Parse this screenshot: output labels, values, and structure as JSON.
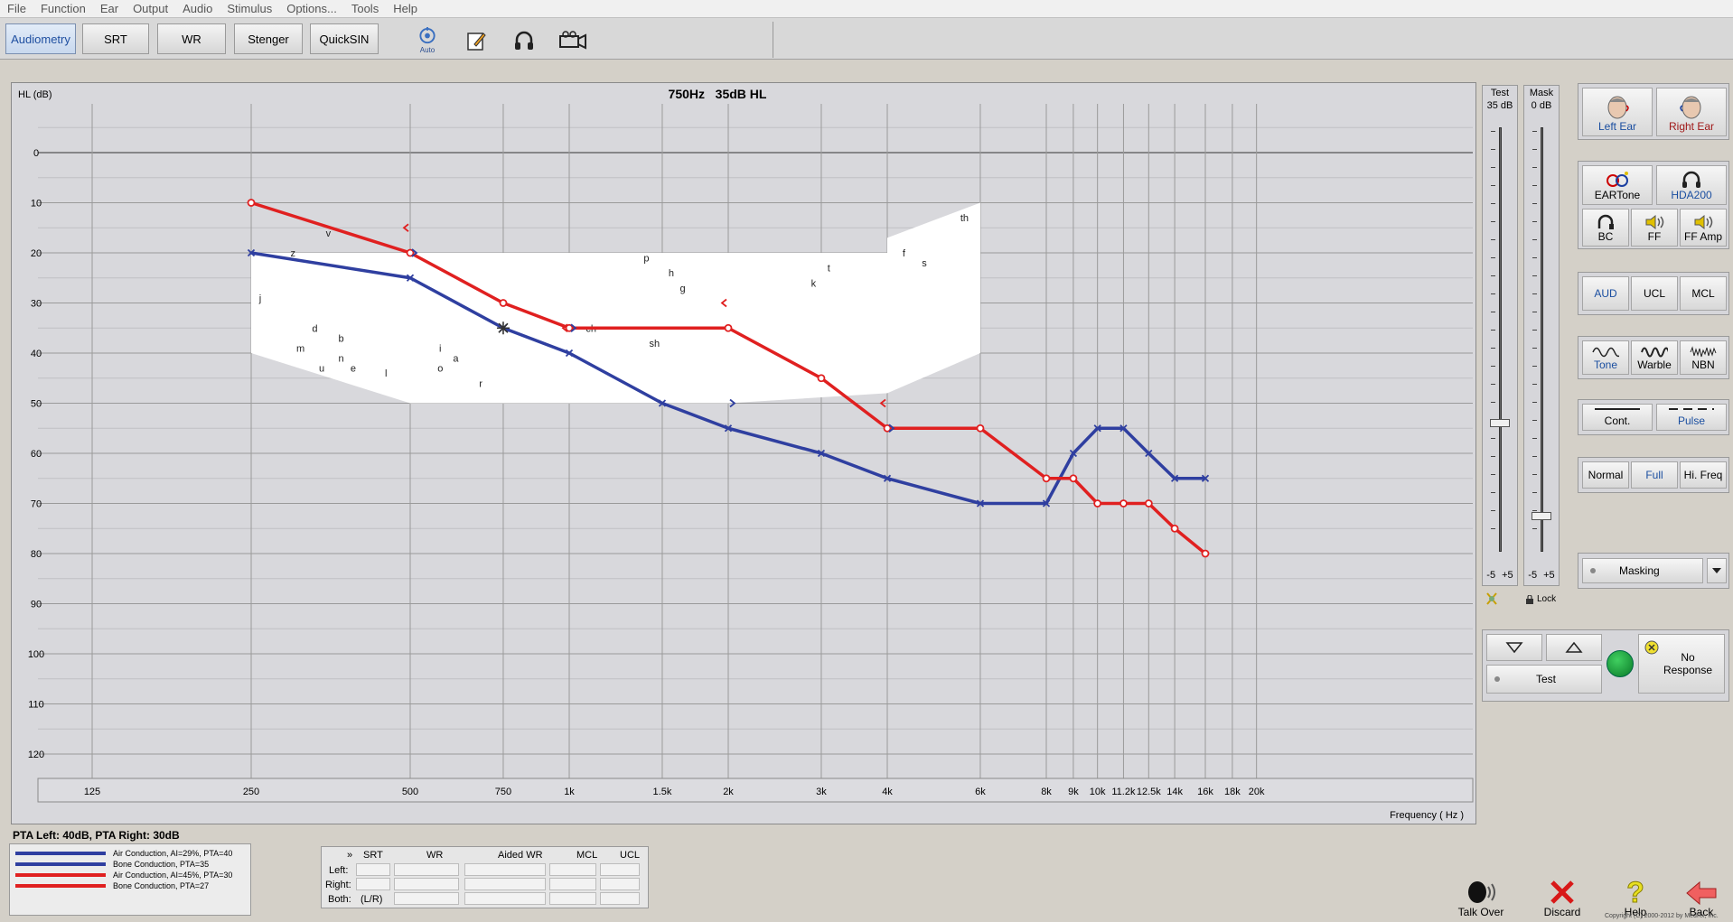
{
  "menu": [
    "File",
    "Function",
    "Ear",
    "Output",
    "Audio",
    "Stimulus",
    "Options...",
    "Tools",
    "Help"
  ],
  "toolbar": {
    "tabs": [
      "Audiometry",
      "SRT",
      "WR",
      "Stenger",
      "QuickSIN"
    ],
    "auto_label": "Auto"
  },
  "graph": {
    "y_label": "HL (dB)",
    "status": "750Hz   35dB HL",
    "x_unit_label": "Frequency ( Hz )",
    "y_ticks": [
      "0",
      "10",
      "20",
      "30",
      "40",
      "50",
      "60",
      "70",
      "80",
      "90",
      "100",
      "110",
      "120"
    ],
    "x_ticks": [
      "125",
      "250",
      "500",
      "750",
      "1k",
      "1.5k",
      "2k",
      "3k",
      "4k",
      "6k",
      "8k",
      "9k",
      "10k",
      "11.2k",
      "12.5k",
      "14k",
      "16k",
      "18k",
      "20k"
    ],
    "speech_sounds": [
      "v",
      "z",
      "j",
      "d",
      "b",
      "m",
      "n",
      "u",
      "e",
      "l",
      "i",
      "a",
      "o",
      "r",
      "p",
      "h",
      "g",
      "ch",
      "sh",
      "k",
      "t",
      "f",
      "s",
      "th"
    ]
  },
  "chart_data": {
    "type": "line",
    "xlabel": "Frequency ( Hz )",
    "ylabel": "HL (dB)",
    "ylim": [
      -10,
      120
    ],
    "y_inverted": true,
    "x_scale": "log",
    "series": [
      {
        "name": "Air Conduction, AI=29%, PTA=40",
        "ear": "left",
        "color": "#2f3fa0",
        "x": [
          250,
          500,
          750,
          1000,
          1500,
          2000,
          3000,
          4000,
          6000,
          8000,
          9000,
          10000,
          11200,
          12500,
          14000,
          16000
        ],
        "y": [
          20,
          25,
          35,
          40,
          50,
          55,
          60,
          65,
          70,
          70,
          60,
          55,
          55,
          60,
          65,
          65
        ]
      },
      {
        "name": "Air Conduction, AI=45%, PTA=30",
        "ear": "right",
        "color": "#e02020",
        "x": [
          250,
          500,
          750,
          1000,
          2000,
          3000,
          4000,
          6000,
          8000,
          9000,
          10000,
          11200,
          12500,
          14000,
          16000
        ],
        "y": [
          10,
          20,
          30,
          35,
          35,
          45,
          55,
          55,
          65,
          65,
          70,
          70,
          70,
          75,
          80
        ]
      },
      {
        "name": "Bone Conduction, PTA=35",
        "ear": "left",
        "color": "#2f3fa0",
        "x": [
          500,
          1000,
          2000,
          4000
        ],
        "y": [
          20,
          35,
          50,
          55
        ]
      },
      {
        "name": "Bone Conduction, PTA=27",
        "ear": "right",
        "color": "#e02020",
        "x": [
          500,
          1000,
          2000,
          4000
        ],
        "y": [
          15,
          35,
          30,
          50
        ]
      }
    ],
    "cursor": {
      "x": 750,
      "y": 35
    }
  },
  "sliders": {
    "test": {
      "title": "Test",
      "value": "35 dB",
      "range": "-5  +5",
      "level_db": 35
    },
    "mask": {
      "title": "Mask",
      "value": "0 dB",
      "range": "-5  +5",
      "level_db": 0
    },
    "lock": "Lock"
  },
  "side": {
    "ears": [
      "Left Ear",
      "Right Ear"
    ],
    "transducers": [
      "EARTone",
      "HDA200",
      "BC",
      "FF",
      "FF Amp"
    ],
    "modes": [
      "AUD",
      "UCL",
      "MCL"
    ],
    "stimulus": [
      "Tone",
      "Warble",
      "NBN"
    ],
    "presentation": [
      "Cont.",
      "Pulse"
    ],
    "range": [
      "Normal",
      "Full",
      "Hi. Freq"
    ],
    "masking": "Masking",
    "test_button": "Test",
    "no_response": "No Response"
  },
  "pta_summary": "PTA Left: 40dB, PTA Right: 30dB",
  "legend": [
    {
      "label": "Air Conduction, AI=29%, PTA=40",
      "color": "#2f3fa0"
    },
    {
      "label": "Bone Conduction, PTA=35",
      "color": "#2f3fa0"
    },
    {
      "label": "Air Conduction, AI=45%, PTA=30",
      "color": "#e02020"
    },
    {
      "label": "Bone Conduction, PTA=27",
      "color": "#e02020"
    }
  ],
  "score_table": {
    "headers": [
      "»",
      "SRT",
      "WR",
      "Aided WR",
      "MCL",
      "UCL"
    ],
    "rows": [
      "Left:",
      "Right:",
      "Both:"
    ],
    "both_srt": "(L/R)"
  },
  "bottom": [
    "Talk Over",
    "Discard",
    "Help",
    "Back"
  ],
  "copyright": "Copyright (C) 2000-2012 by MedRx, Inc."
}
